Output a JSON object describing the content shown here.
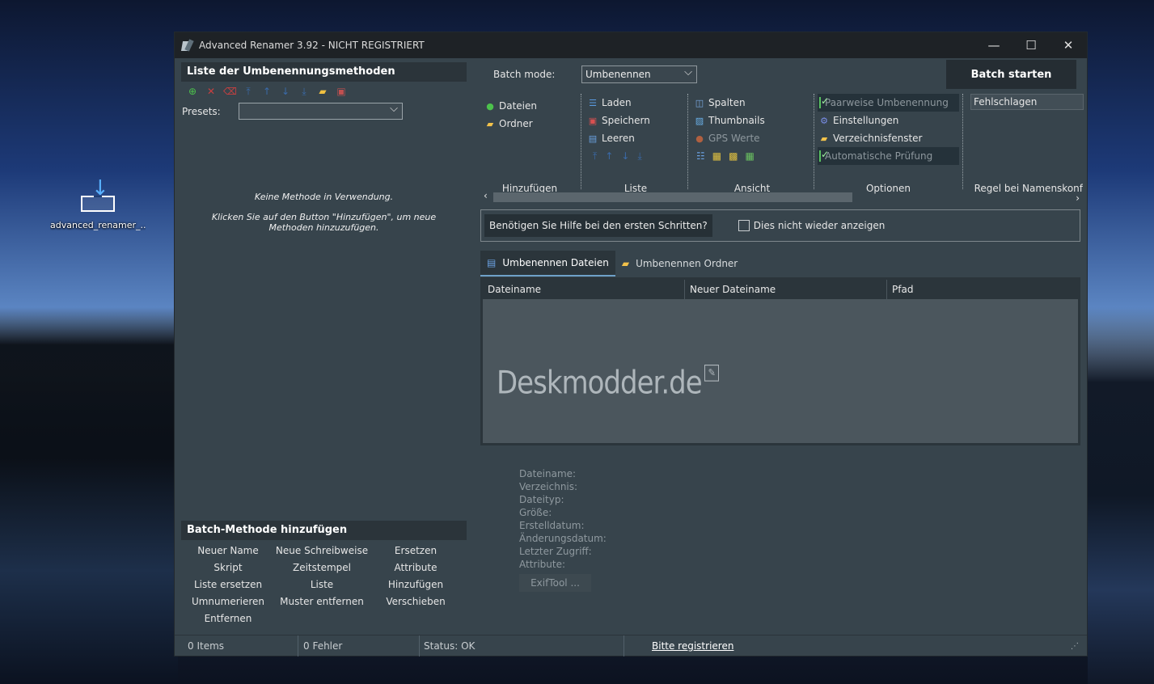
{
  "desktop": {
    "icon_label": "advanced_renamer_..."
  },
  "window": {
    "title": "Advanced Renamer 3.92 - NICHT REGISTRIERT",
    "controls": {
      "minimize": "—",
      "maximize": "☐",
      "close": "✕"
    }
  },
  "left": {
    "methods_header": "Liste der Umbenennungsmethoden",
    "toolbar_icons": [
      "add-icon",
      "delete-icon",
      "eraser-icon",
      "move-top-icon",
      "move-up-icon",
      "move-down-icon",
      "move-bottom-icon",
      "open-folder-icon",
      "save-icon"
    ],
    "presets_label": "Presets:",
    "presets_value": "",
    "empty_line1": "Keine Methode in Verwendung.",
    "empty_line2": "Klicken Sie auf den Button \"Hinzufügen\", um neue Methoden hinzuzufügen.",
    "batch_header": "Batch-Methode hinzufügen",
    "methods": [
      "Neuer Name",
      "Neue Schreibweise",
      "Ersetzen",
      "Skript",
      "Zeitstempel",
      "Attribute",
      "Liste ersetzen",
      "Liste",
      "Hinzufügen",
      "Umnumerieren",
      "Muster entfernen",
      "Verschieben",
      "Entfernen"
    ]
  },
  "right": {
    "batch_mode_label": "Batch mode:",
    "batch_mode_value": "Umbenennen",
    "batch_start": "Batch starten",
    "ribbon": {
      "hinzufuegen": {
        "title": "Hinzufügen",
        "items": [
          "Dateien",
          "Ordner"
        ]
      },
      "liste": {
        "title": "Liste",
        "items": [
          "Laden",
          "Speichern",
          "Leeren"
        ]
      },
      "ansicht": {
        "title": "Ansicht",
        "items": [
          "Spalten",
          "Thumbnails",
          "GPS Werte"
        ]
      },
      "optionen": {
        "title": "Optionen",
        "items": [
          "Paarweise Umbenennung",
          "Einstellungen",
          "Verzeichnisfenster",
          "Automatische Prüfung"
        ]
      },
      "regel": {
        "title": "Regel bei Namenskonf",
        "value": "Fehlschlagen"
      }
    },
    "help_button": "Benötigen Sie Hilfe bei den ersten Schritten?",
    "help_checkbox": "Dies nicht wieder anzeigen",
    "tabs": [
      "Umbenennen Dateien",
      "Umbenennen Ordner"
    ],
    "columns": [
      "Dateiname",
      "Neuer Dateiname",
      "Pfad"
    ],
    "watermark": "Deskmodder.de",
    "props": [
      "Dateiname:",
      "Verzeichnis:",
      "Dateityp:",
      "Größe:",
      "Erstelldatum:",
      "Änderungsdatum:",
      "Letzter Zugriff:",
      "Attribute:"
    ],
    "exif_button": "ExifTool ..."
  },
  "status": {
    "items": "0 Items",
    "errors": "0 Fehler",
    "status": "Status: OK",
    "register": "Bitte registrieren"
  },
  "colors": {
    "window_bg": "#37444c",
    "titlebar_bg": "#1e2226",
    "header_bg": "#2b343a",
    "grid_bg": "#4b565d"
  }
}
